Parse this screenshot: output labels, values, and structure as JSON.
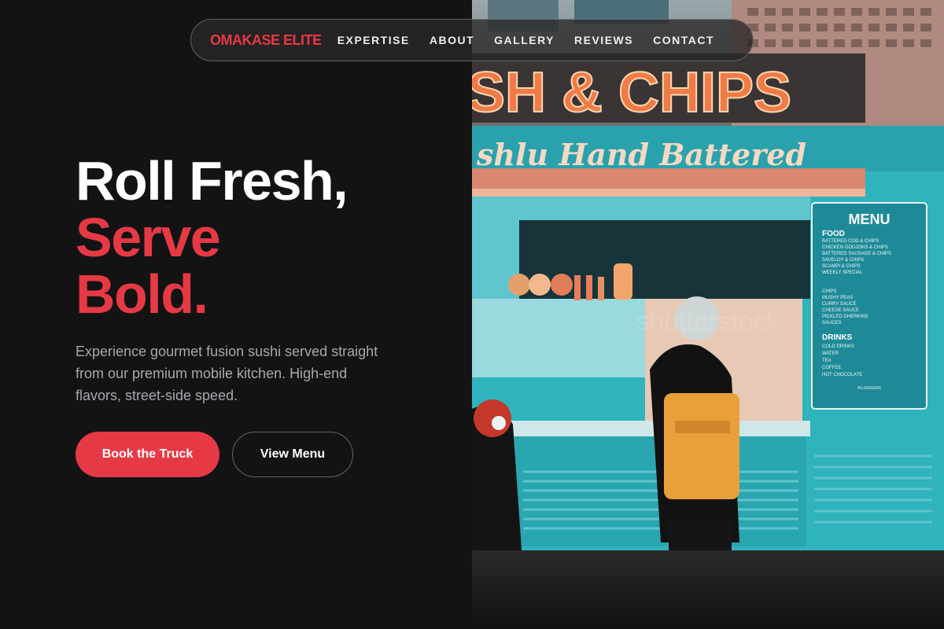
{
  "nav": {
    "brand": "OMAKASE ELITE",
    "links": [
      "EXPERTISE",
      "ABOUT",
      "GALLERY",
      "REVIEWS",
      "CONTACT"
    ]
  },
  "hero": {
    "title_line1": "Roll Fresh,",
    "title_line2": "Serve",
    "title_line3": "Bold.",
    "description": "Experience gourmet fusion sushi served straight from our premium mobile kitchen. High-end flavors, street-side speed.",
    "primary_button": "Book the Truck",
    "secondary_button": "View Menu"
  },
  "image": {
    "sign_main": "SH & CHIPS",
    "sign_sub": "shlu Hand Battered",
    "menu_title": "MENU",
    "menu_food_heading": "FOOD",
    "menu_food_items": [
      "BATTERED COD & CHIPS",
      "CHICKEN GOUJONS & CHIPS",
      "BATTERED SAUSAGE & CHIPS",
      "SAVELOY & CHIPS",
      "SCAMPI & CHIPS",
      "WEEKLY SPECIAL"
    ],
    "menu_sides_items": [
      "CHIPS",
      "MUSHY PEAS",
      "CURRY SAUCE",
      "CHEESE SAUCE",
      "PICKLED GHERKINS",
      "SAUCES"
    ],
    "menu_drinks_heading": "DRINKS",
    "menu_drinks_items": [
      "COLD DRINKS",
      "WATER",
      "TEA",
      "COFFEE",
      "HOT CHOCOLATE"
    ],
    "menu_footer": "ALLERGENS",
    "watermark": "shutterstock"
  },
  "colors": {
    "accent": "#e63946",
    "background": "#131313",
    "text_muted": "#a7a9b0",
    "truck_teal": "#2fb3bd"
  }
}
